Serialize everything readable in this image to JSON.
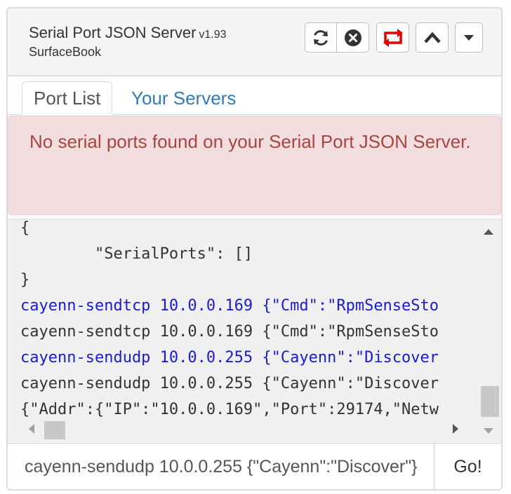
{
  "header": {
    "title": "Serial Port JSON Server",
    "version": "v1.93",
    "subtitle": "SurfaceBook",
    "icons": [
      "refresh-icon",
      "close-circle-icon",
      "retweet-icon",
      "chevron-up-icon",
      "caret-down-icon"
    ],
    "accent_color": "#e00000"
  },
  "tabs": [
    {
      "label": "Port List",
      "active": true
    },
    {
      "label": "Your Servers",
      "active": false
    }
  ],
  "alert": {
    "message": "No serial ports found on your Serial Port JSON Server.",
    "bg_color": "#f2dede",
    "text_color": "#a94442"
  },
  "console": {
    "lines": [
      {
        "text": "{",
        "color": "dark"
      },
      {
        "text": "        \"SerialPorts\": []",
        "color": "dark"
      },
      {
        "text": "}",
        "color": "dark"
      },
      {
        "text": "cayenn-sendtcp 10.0.0.169 {\"Cmd\":\"RpmSenseSto",
        "color": "blue"
      },
      {
        "text": "cayenn-sendtcp 10.0.0.169 {\"Cmd\":\"RpmSenseSto",
        "color": "dark"
      },
      {
        "text": "cayenn-sendudp 10.0.0.255 {\"Cayenn\":\"Discover",
        "color": "blue"
      },
      {
        "text": "cayenn-sendudp 10.0.0.255 {\"Cayenn\":\"Discover",
        "color": "dark"
      },
      {
        "text": "{\"Addr\":{\"IP\":\"10.0.0.169\",\"Port\":29174,\"Netw",
        "color": "dark"
      }
    ]
  },
  "command": {
    "value": "cayenn-sendudp 10.0.0.255 {\"Cayenn\":\"Discover\"}",
    "go_label": "Go!"
  }
}
